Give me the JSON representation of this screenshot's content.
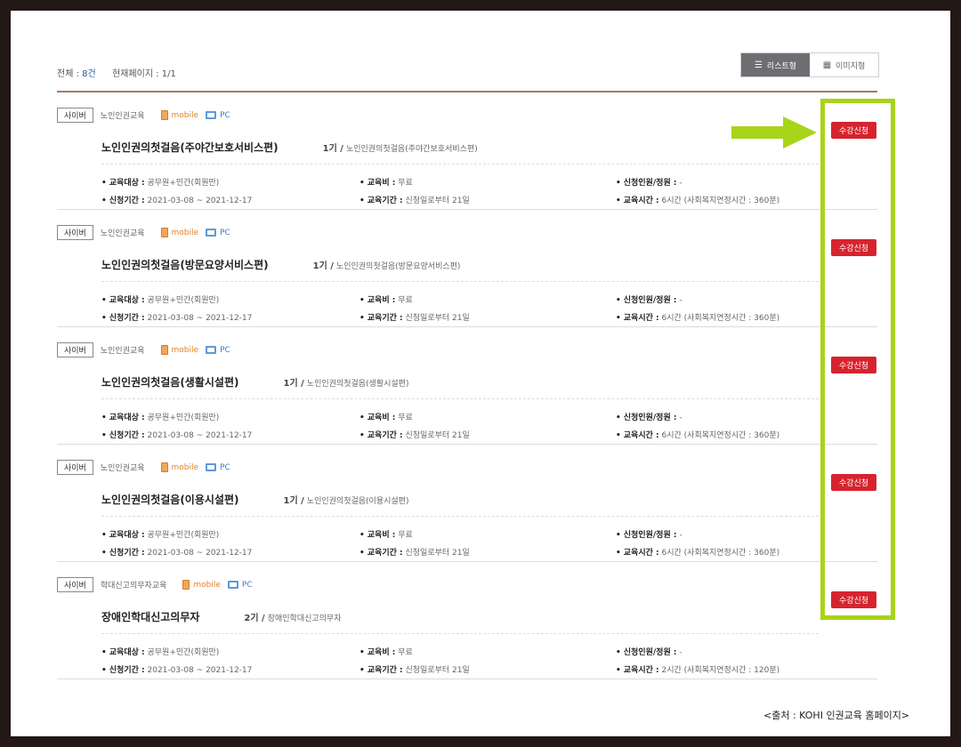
{
  "summary": {
    "total_label": "전체 : ",
    "total_count": "8건",
    "page_label": "현재페이지 : 1/1"
  },
  "view_toggle": {
    "list_label": "리스트형",
    "image_label": "이미지형"
  },
  "courses": [
    {
      "type": "사이버",
      "category": "노인인권교육",
      "mobile": "mobile",
      "pc": "PC",
      "title": "노인인권의첫걸음(주야간보호서비스편)",
      "generation": "1기 /",
      "generation_name": "노인인권의첫걸음(주야간보호서비스편)",
      "target_label": "교육대상 :",
      "target": "공무원+민간(회원만)",
      "fee_label": "교육비 :",
      "fee": "무료",
      "capacity_label": "신청인원/정원 :",
      "capacity": "-",
      "apply_period_label": "신청기간 :",
      "apply_period": "2021-03-08 ~ 2021-12-17",
      "edu_period_label": "교육기간 :",
      "edu_period": "신청일로부터 21일",
      "edu_time_label": "교육시간 :",
      "edu_time": "6시간 (사회복지연정시간 : 360분)",
      "apply_button": "수강신청"
    },
    {
      "type": "사이버",
      "category": "노인인권교육",
      "mobile": "mobile",
      "pc": "PC",
      "title": "노인인권의첫걸음(방문요양서비스편)",
      "generation": "1기 /",
      "generation_name": "노인인권의첫걸음(방문요양서비스편)",
      "target_label": "교육대상 :",
      "target": "공무원+민간(회원만)",
      "fee_label": "교육비 :",
      "fee": "무료",
      "capacity_label": "신청인원/정원 :",
      "capacity": "-",
      "apply_period_label": "신청기간 :",
      "apply_period": "2021-03-08 ~ 2021-12-17",
      "edu_period_label": "교육기간 :",
      "edu_period": "신청일로부터 21일",
      "edu_time_label": "교육시간 :",
      "edu_time": "6시간 (사회복지연정시간 : 360분)",
      "apply_button": "수강신청"
    },
    {
      "type": "사이버",
      "category": "노인인권교육",
      "mobile": "mobile",
      "pc": "PC",
      "title": "노인인권의첫걸음(생활시설편)",
      "generation": "1기 /",
      "generation_name": "노인인권의첫걸음(생활시설편)",
      "target_label": "교육대상 :",
      "target": "공무원+민간(회원만)",
      "fee_label": "교육비 :",
      "fee": "무료",
      "capacity_label": "신청인원/정원 :",
      "capacity": "-",
      "apply_period_label": "신청기간 :",
      "apply_period": "2021-03-08 ~ 2021-12-17",
      "edu_period_label": "교육기간 :",
      "edu_period": "신청일로부터 21일",
      "edu_time_label": "교육시간 :",
      "edu_time": "6시간 (사회복지연정시간 : 360분)",
      "apply_button": "수강신청"
    },
    {
      "type": "사이버",
      "category": "노인인권교육",
      "mobile": "mobile",
      "pc": "PC",
      "title": "노인인권의첫걸음(이용시설편)",
      "generation": "1기 /",
      "generation_name": "노인인권의첫걸음(이용시설편)",
      "target_label": "교육대상 :",
      "target": "공무원+민간(회원만)",
      "fee_label": "교육비 :",
      "fee": "무료",
      "capacity_label": "신청인원/정원 :",
      "capacity": "-",
      "apply_period_label": "신청기간 :",
      "apply_period": "2021-03-08 ~ 2021-12-17",
      "edu_period_label": "교육기간 :",
      "edu_period": "신청일로부터 21일",
      "edu_time_label": "교육시간 :",
      "edu_time": "6시간 (사회복지연정시간 : 360분)",
      "apply_button": "수강신청"
    },
    {
      "type": "사이버",
      "category": "학대신고의무자교육",
      "mobile": "mobile",
      "pc": "PC",
      "title": "장애인학대신고의무자",
      "generation": "2기 /",
      "generation_name": "장애인학대신고의무자",
      "target_label": "교육대상 :",
      "target": "공무원+민간(회원만)",
      "fee_label": "교육비 :",
      "fee": "무료",
      "capacity_label": "신청인원/정원 :",
      "capacity": "-",
      "apply_period_label": "신청기간 :",
      "apply_period": "2021-03-08 ~ 2021-12-17",
      "edu_period_label": "교육기간 :",
      "edu_period": "신청일로부터 21일",
      "edu_time_label": "교육시간 :",
      "edu_time": "2시간 (사회복지연정시간 : 120분)",
      "apply_button": "수강신청"
    }
  ],
  "annotation": {
    "highlight_color": "#a8d41a",
    "arrow_color": "#a8d41a"
  },
  "colors": {
    "apply_button": "#d6242f",
    "active_toggle": "#6d6e71",
    "top_line": "#a5786b"
  },
  "credit": "<출처 : KOHI 인권교육 홈페이지>"
}
